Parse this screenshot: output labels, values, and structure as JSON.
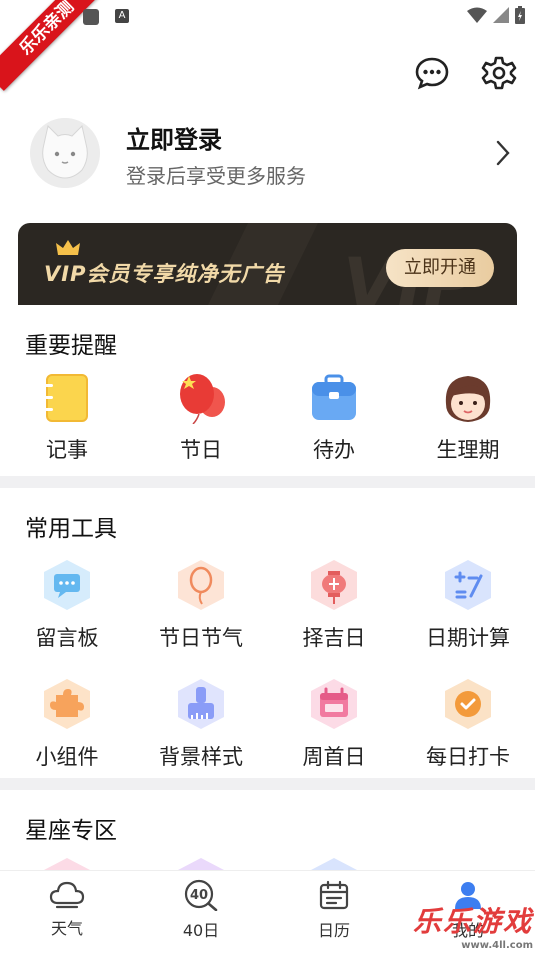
{
  "status_bar": {
    "ribbon_text": "乐乐亲测",
    "a_badge": "A"
  },
  "header": {
    "message_icon": "message-icon",
    "settings_icon": "settings-icon"
  },
  "login": {
    "title": "立即登录",
    "subtitle": "登录后享受更多服务"
  },
  "vip": {
    "text": "VIP会员专享纯净无广告",
    "button": "立即开通",
    "bg_text": "VIP"
  },
  "reminders": {
    "title": "重要提醒",
    "items": [
      {
        "label": "记事",
        "icon": "notebook-icon"
      },
      {
        "label": "节日",
        "icon": "balloon-icon"
      },
      {
        "label": "待办",
        "icon": "briefcase-icon"
      },
      {
        "label": "生理期",
        "icon": "girl-face-icon"
      }
    ]
  },
  "tools": {
    "title": "常用工具",
    "items": [
      {
        "label": "留言板",
        "icon": "message-board-icon",
        "color": "#64b8f0"
      },
      {
        "label": "节日节气",
        "icon": "balloon-outline-icon",
        "color": "#f4a582"
      },
      {
        "label": "择吉日",
        "icon": "lantern-icon",
        "color": "#f07a7a"
      },
      {
        "label": "日期计算",
        "icon": "calculator-icon",
        "color": "#5f8cf0"
      },
      {
        "label": "小组件",
        "icon": "puzzle-icon",
        "color": "#f7a35c"
      },
      {
        "label": "背景样式",
        "icon": "brush-icon",
        "color": "#8a9cf7"
      },
      {
        "label": "周首日",
        "icon": "calendar-icon",
        "color": "#f17aa0"
      },
      {
        "label": "每日打卡",
        "icon": "checkin-icon",
        "color": "#f39a3b"
      }
    ]
  },
  "zodiac": {
    "title": "星座专区"
  },
  "tabbar": {
    "items": [
      {
        "label": "天气",
        "icon": "cloud-icon"
      },
      {
        "label": "40日",
        "icon": "forty-day-icon",
        "icon_text": "40"
      },
      {
        "label": "日历",
        "icon": "calendar-tab-icon"
      },
      {
        "label": "我的",
        "icon": "profile-icon"
      }
    ]
  },
  "watermark": {
    "text": "乐乐游戏",
    "url": "www.4ll.com"
  }
}
